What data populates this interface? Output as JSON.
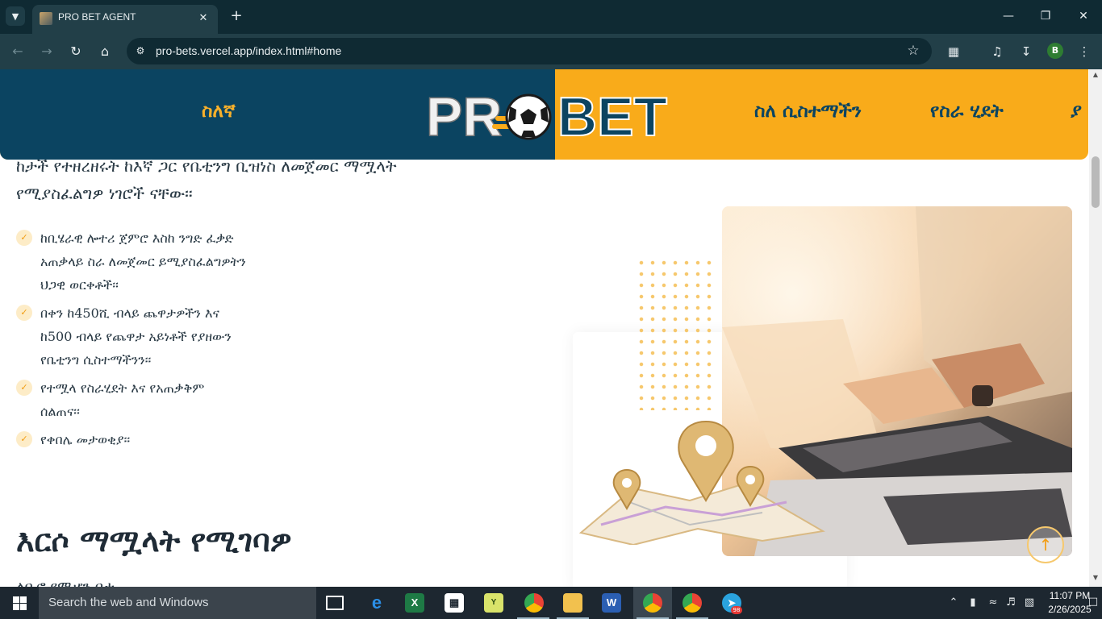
{
  "browser": {
    "tab_title": "PRO BET AGENT",
    "url": "pro-bets.vercel.app/index.html#home",
    "profile_initial": "B"
  },
  "header": {
    "logo_alt": "PRO BET",
    "logo_word_left": "PR",
    "logo_word_right": "BET",
    "nav_left": "ስለኛ",
    "nav_right_1": "ስለ ሲስተማችን",
    "nav_right_2": "የስራ ሂደት",
    "nav_right_3": "ያ",
    "colors": {
      "dark": "#0b4461",
      "accent": "#f9ab1a"
    }
  },
  "content": {
    "intro_line1": "ከታች የተዘረዘሩት ከእኛ ጋር የቤቲንግ ቢዝነስ ለመጀመር ማሟላት",
    "intro_line2": "የሚያስፈልግዎ ነገሮች ናቸው፡፡",
    "checklist": [
      "ከቢሄራዊ ሎተሪ ጀምሮ እስከ ንግድ ፈቃድ አጠቃላይ ስራ ለመጀመር ይሚያስፈልግዎትን ህጋዊ ወርቀቶች፡፡",
      "በቀን ከ450ሺ ብላይ ጨዋታዎችን እና ከ500 ብላይ የጨዋታ አይነቶች የያዘውን የቤቲንግ ሲስተማችንን፡፡",
      "የተሟላ የስራሂደት እና የአጠቃቅም ሰልጠና፡፡",
      "የቀበሌ መታወቂያ፡፡"
    ],
    "section_heading": "እርሶ ማሟላት የሚገባዎ",
    "cutoff_text": "ለቢሮ የሚሆን ቦታ"
  },
  "taskbar": {
    "search_placeholder": "Search the web and Windows",
    "time": "11:07 PM",
    "date": "2/26/2025",
    "telegram_badge": "98",
    "chrome_profile": "B"
  }
}
